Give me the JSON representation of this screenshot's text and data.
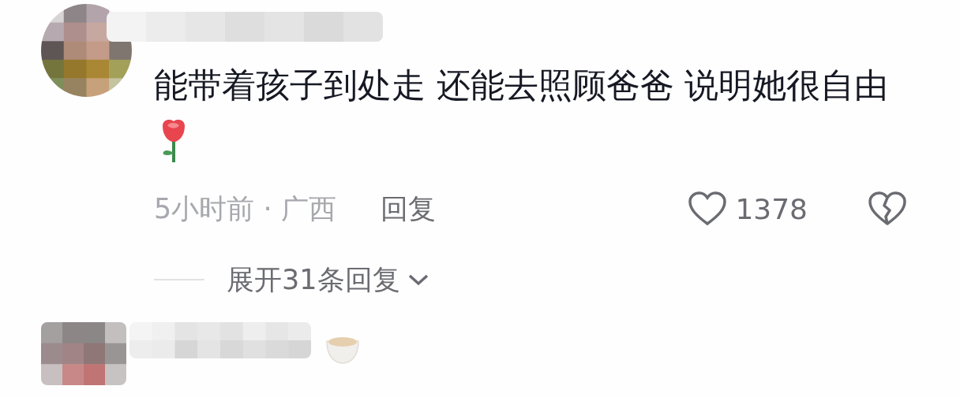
{
  "comments": [
    {
      "text": "能带着孩子到处走 还能去照顾爸爸 说明她很自由",
      "time_location": "5小时前 · 广西",
      "reply": "回复",
      "likes": "1378",
      "expand": "展开31条回复"
    }
  ]
}
